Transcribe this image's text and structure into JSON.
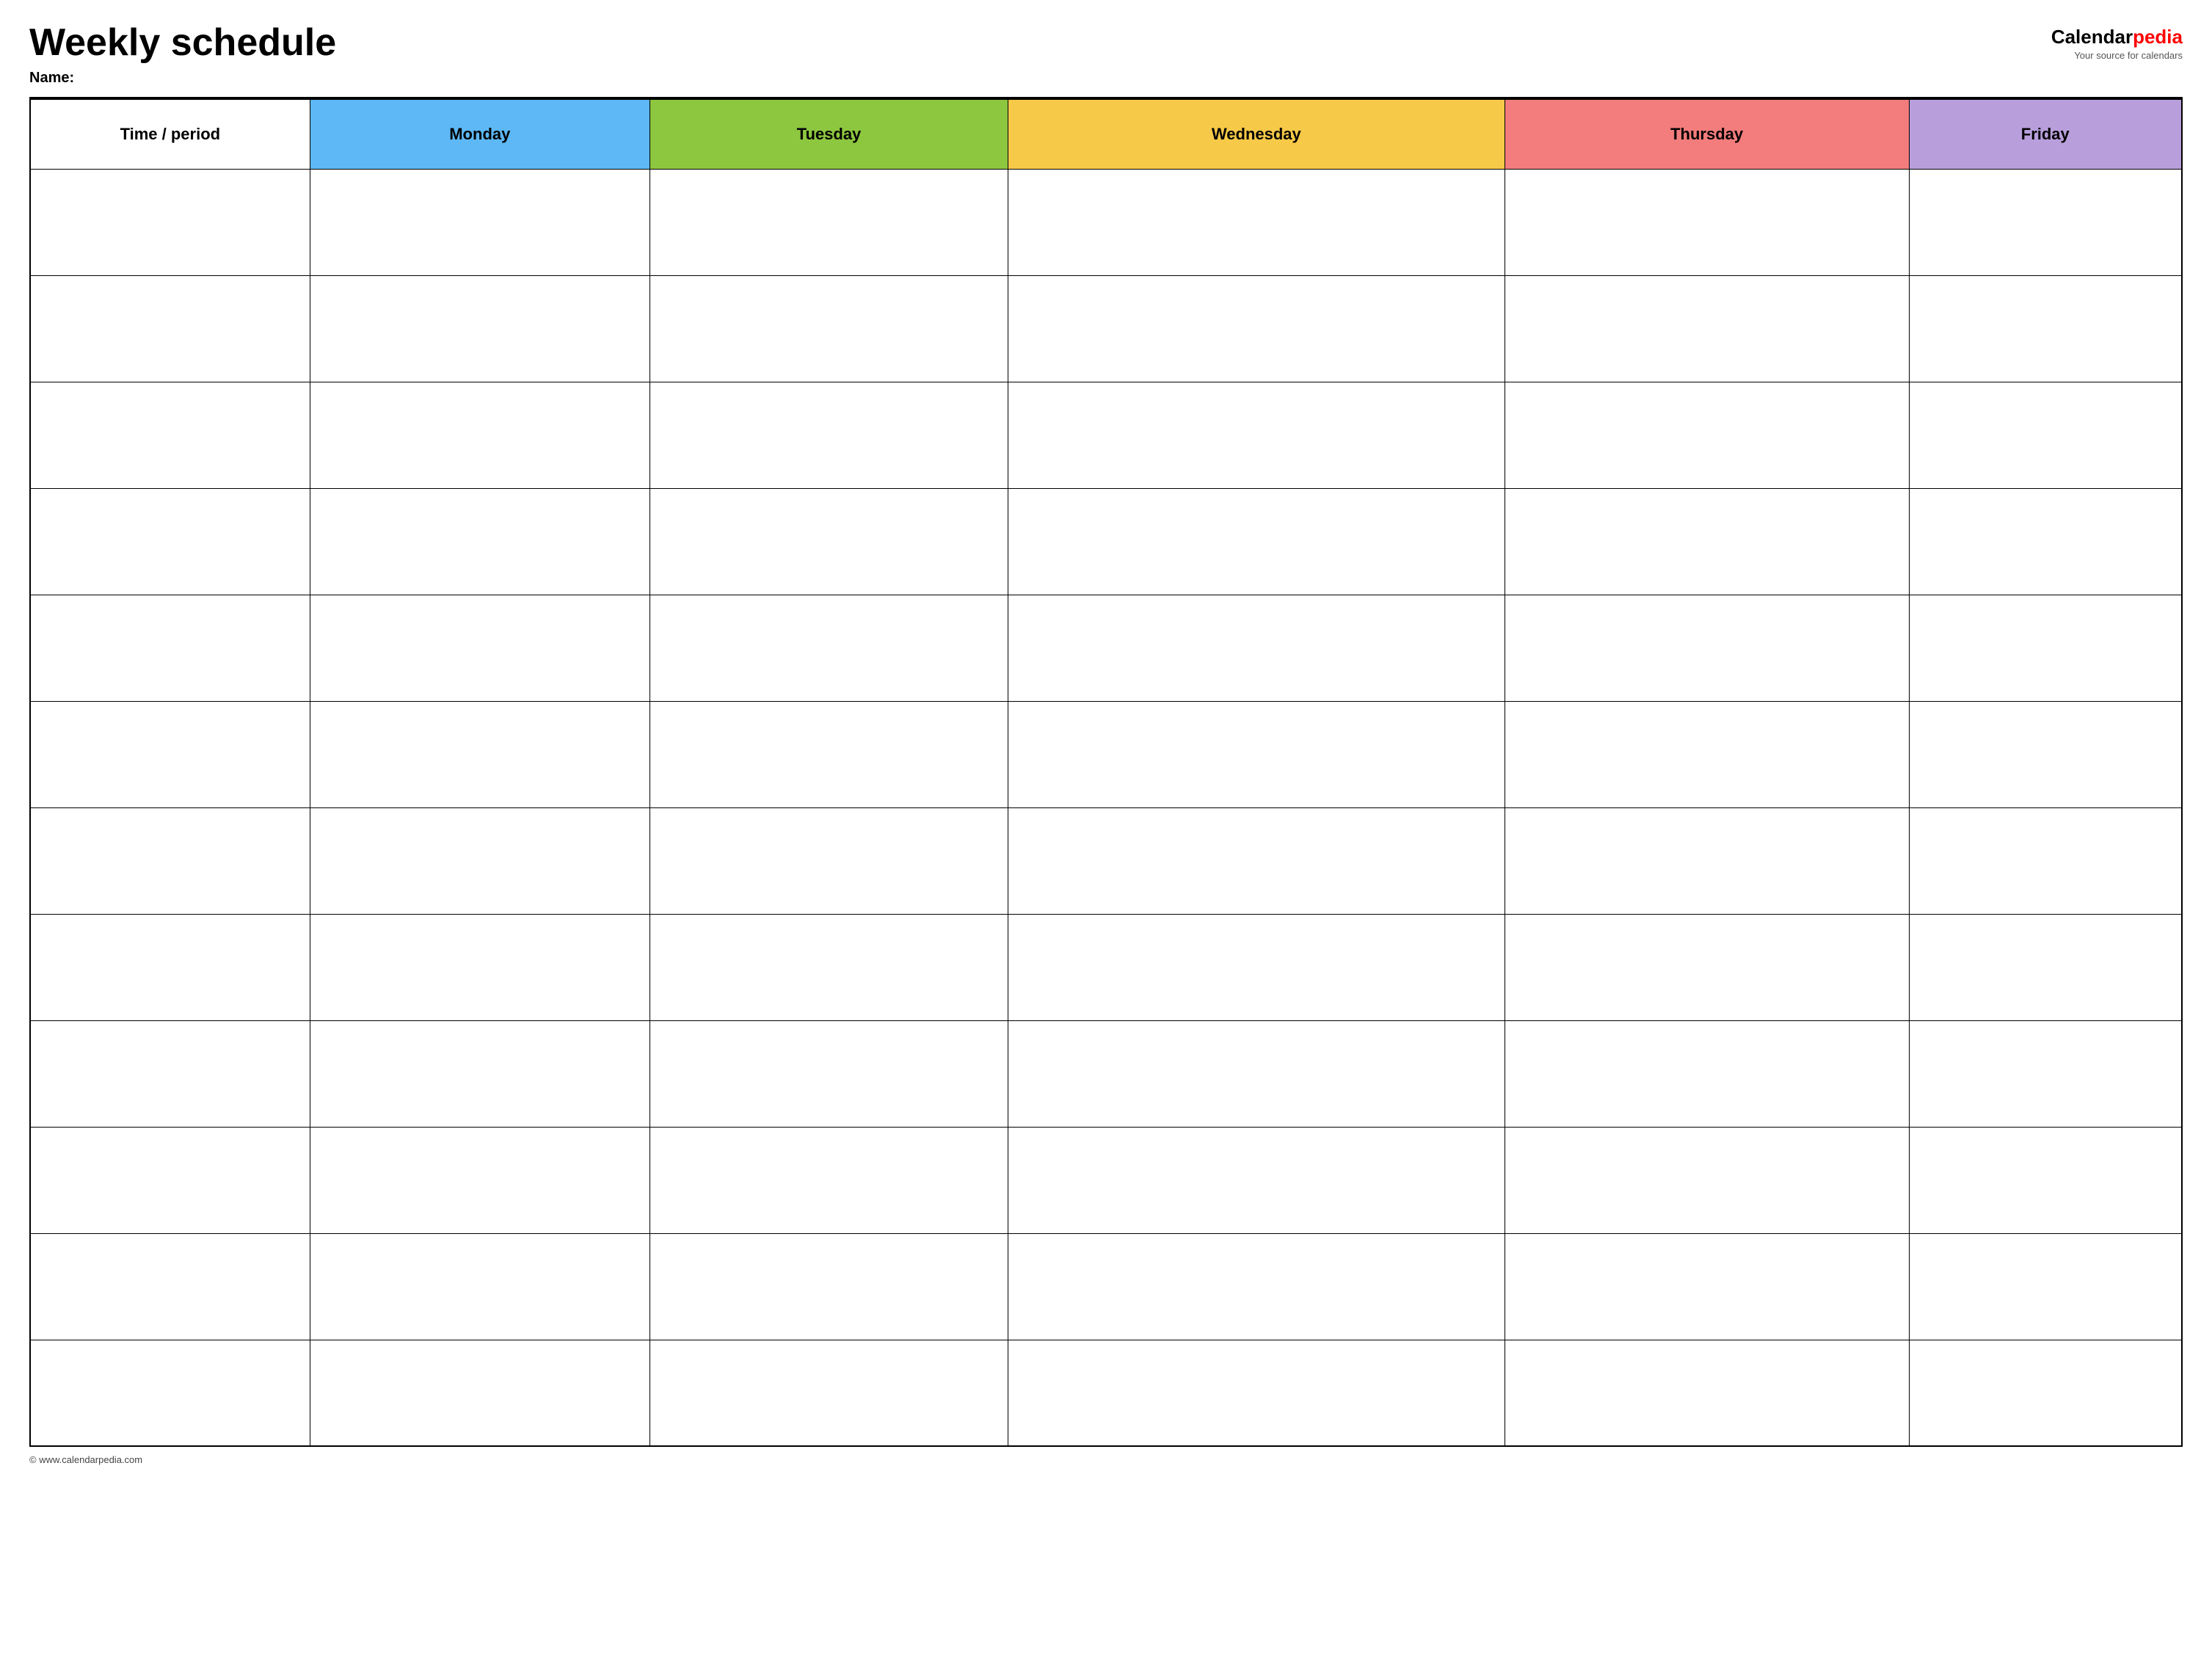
{
  "header": {
    "title": "Weekly schedule",
    "name_label": "Name:",
    "logo": "Calendarpedia",
    "logo_calendar": "Calendar",
    "logo_pedia": "pedia",
    "logo_tagline": "Your source for calendars"
  },
  "table": {
    "columns": [
      {
        "id": "time",
        "label": "Time / period",
        "color_class": "col-time"
      },
      {
        "id": "monday",
        "label": "Monday",
        "color_class": "col-monday"
      },
      {
        "id": "tuesday",
        "label": "Tuesday",
        "color_class": "col-tuesday"
      },
      {
        "id": "wednesday",
        "label": "Wednesday",
        "color_class": "col-wednesday"
      },
      {
        "id": "thursday",
        "label": "Thursday",
        "color_class": "col-thursday"
      },
      {
        "id": "friday",
        "label": "Friday",
        "color_class": "col-friday"
      }
    ],
    "row_count": 12
  },
  "footer": {
    "copyright": "© www.calendarpedia.com"
  }
}
